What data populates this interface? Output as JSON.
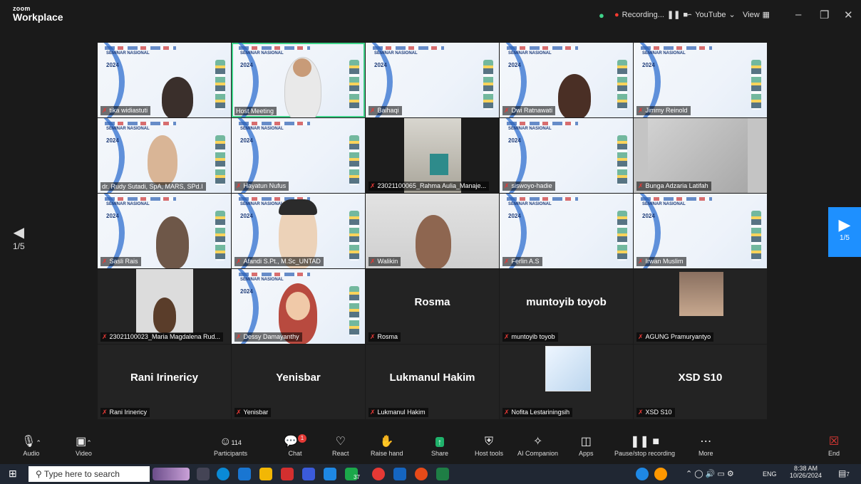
{
  "titlebar": {
    "logo_top": "zoom",
    "logo_bottom": "Workplace",
    "recording": "Recording...",
    "youtube": "YouTube",
    "view": "View"
  },
  "slide": {
    "seminar": "SEMINAR NASIONAL",
    "year": "2024"
  },
  "tiles": [
    {
      "name": "tika widiastuti"
    },
    {
      "name": "Host Meeting"
    },
    {
      "name": "Baihaqi"
    },
    {
      "name": "Dwi Ratnawati"
    },
    {
      "name": "Jimmy Reinold"
    },
    {
      "name": "dr. Rudy Sutadi, SpA, MARS, SPd.I"
    },
    {
      "name": "Hayatun Nufus"
    },
    {
      "name": "23021100065_Rahma Aulia_Manaje..."
    },
    {
      "name": "siswoyo-hadie"
    },
    {
      "name": "Bunga Adzaria Latifah"
    },
    {
      "name": "Sasli Rais"
    },
    {
      "name": "Afandi S.Pt., M.Sc_UNTAD"
    },
    {
      "name": "Walikin"
    },
    {
      "name": "Ferlin A.S"
    },
    {
      "name": "Irwan Muslim"
    },
    {
      "name": "23021100023_Maria Magdalena Rud..."
    },
    {
      "name": "Dessy Damayanthy"
    },
    {
      "name": "Rosma",
      "big": "Rosma"
    },
    {
      "name": "muntoyib toyob",
      "big": "muntoyib toyob"
    },
    {
      "name": "AGUNG Pramuryantyo"
    },
    {
      "name": "Rani Irinericy",
      "big": "Rani Irinericy"
    },
    {
      "name": "Yenisbar",
      "big": "Yenisbar"
    },
    {
      "name": "Lukmanul Hakim",
      "big": "Lukmanul Hakim"
    },
    {
      "name": "Nofita Lestariningsih"
    },
    {
      "name": "XSD S10",
      "big": "XSD S10"
    }
  ],
  "paging": {
    "left": "1/5",
    "right": "1/5"
  },
  "toolbar": {
    "audio": "Audio",
    "video": "Video",
    "participants": "Participants",
    "participants_count": "114",
    "chat": "Chat",
    "chat_badge": "1",
    "react": "React",
    "raise_hand": "Raise hand",
    "share": "Share",
    "host_tools": "Host tools",
    "ai_companion": "AI Companion",
    "apps": "Apps",
    "pause_recording": "Pause/stop recording",
    "more": "More",
    "end": "End"
  },
  "taskbar": {
    "search_placeholder": "Type here to search",
    "chrome_badge": "37",
    "lang": "ENG",
    "time": "8:38 AM",
    "date": "10/26/2024",
    "notif_count": "7"
  }
}
